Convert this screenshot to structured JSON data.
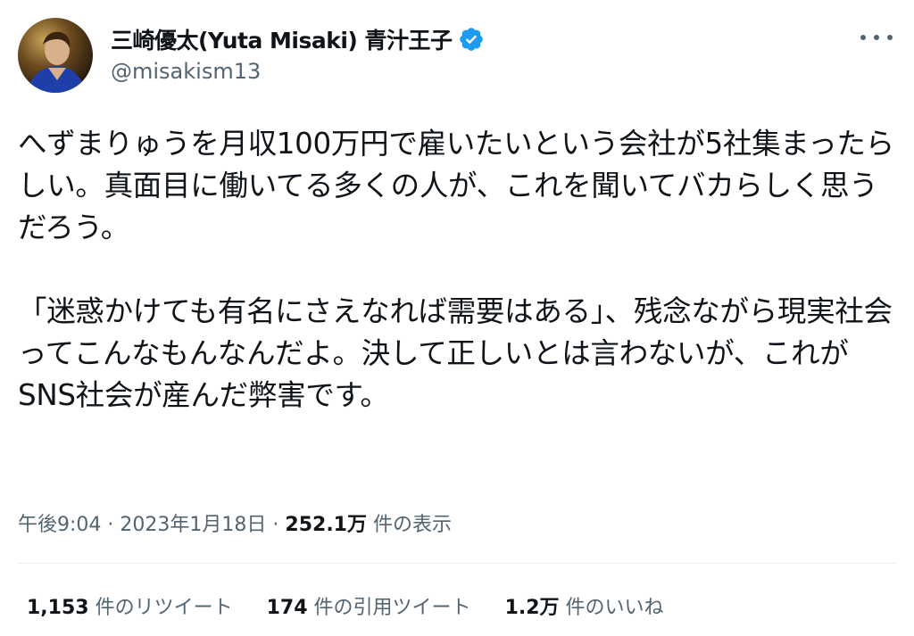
{
  "author": {
    "display_name": "三崎優太(Yuta Misaki) 青汁王子",
    "handle": "@misakism13",
    "verified": true,
    "accent_color": "#1d9bf0"
  },
  "tweet": {
    "text": "へずまりゅうを月収100万円で雇いたいという会社が5社集まったらしい。真面目に働いてる多くの人が、これを聞いてバカらしく思うだろう。\n\n「迷惑かけても有名にさえなれば需要はある」、残念ながら現実社会ってこんなもんなんだよ。決して正しいとは言わないが、これがSNS社会が産んだ弊害です。"
  },
  "meta": {
    "time": "午後9:04",
    "separator": "·",
    "date": "2023年1月18日",
    "views_count": "252.1万",
    "views_label": "件の表示"
  },
  "stats": {
    "retweets_count": "1,153",
    "retweets_label": "件のリツイート",
    "quotes_count": "174",
    "quotes_label": "件の引用ツイート",
    "likes_count": "1.2万",
    "likes_label": "件のいいね"
  },
  "icons": {
    "verified": "verified-badge-icon",
    "more": "more-options-icon"
  }
}
